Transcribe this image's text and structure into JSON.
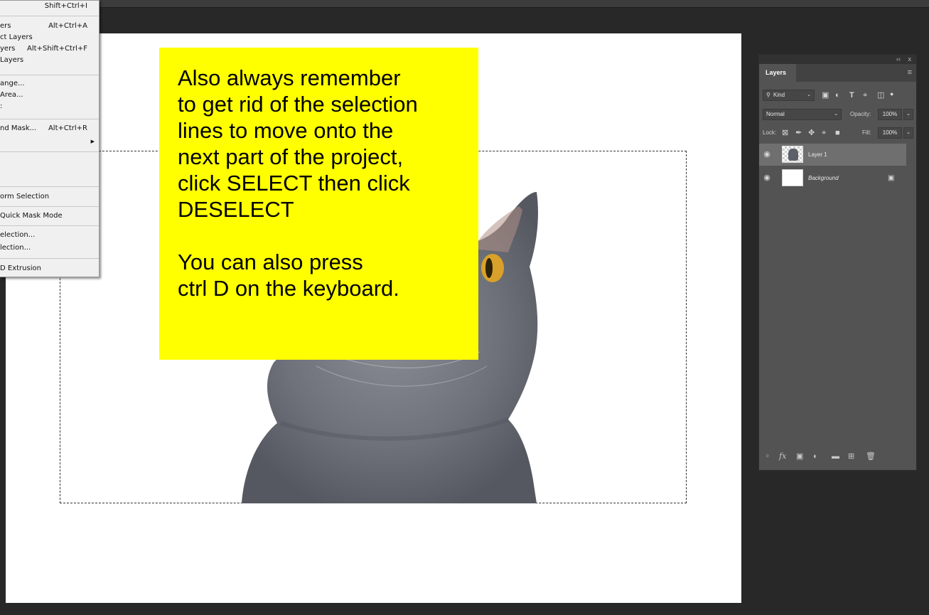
{
  "menu": {
    "items": [
      {
        "label": "",
        "shortcut": "Shift+Ctrl+I"
      },
      {
        "label": "ers",
        "shortcut": "Alt+Ctrl+A"
      },
      {
        "label": "ct Layers",
        "shortcut": ""
      },
      {
        "label": "yers",
        "shortcut": "Alt+Shift+Ctrl+F"
      },
      {
        "label": "Layers",
        "shortcut": ""
      },
      {
        "label": "ange...",
        "shortcut": ""
      },
      {
        "label": "Area...",
        "shortcut": ""
      },
      {
        "label": ":",
        "shortcut": ""
      },
      {
        "label": "nd Mask...",
        "shortcut": "Alt+Ctrl+R"
      },
      {
        "label": "",
        "shortcut": ""
      },
      {
        "label": "orm Selection",
        "shortcut": ""
      },
      {
        "label": "Quick Mask Mode",
        "shortcut": ""
      },
      {
        "label": "election...",
        "shortcut": ""
      },
      {
        "label": "lection...",
        "shortcut": ""
      },
      {
        "label": "D Extrusion",
        "shortcut": ""
      }
    ]
  },
  "note": {
    "line1": "Also always remember",
    "line2": "to get rid of the selection",
    "line3": "lines to move onto the",
    "line4": "next part of the project,",
    "line5": "click SELECT then click",
    "line6": "DESELECT",
    "line7": "You can also press",
    "line8": "ctrl D on the keyboard."
  },
  "layers_panel": {
    "collapse_glyph": "‹‹",
    "close_glyph": "x",
    "tab": "Layers",
    "filter_kind": "Kind",
    "blend_mode": "Normal",
    "opacity_label": "Opacity:",
    "opacity_value": "100%",
    "lock_label": "Lock:",
    "fill_label": "Fill:",
    "fill_value": "100%",
    "layers": [
      {
        "name": "Layer 1",
        "selected": true,
        "visible": true
      },
      {
        "name": "Background",
        "selected": false,
        "visible": true,
        "locked": true
      }
    ]
  },
  "colors": {
    "note_bg": "#ffff00",
    "panel_bg": "#535353",
    "workspace_bg": "#282828",
    "selected_layer": "#6f6f6f"
  }
}
